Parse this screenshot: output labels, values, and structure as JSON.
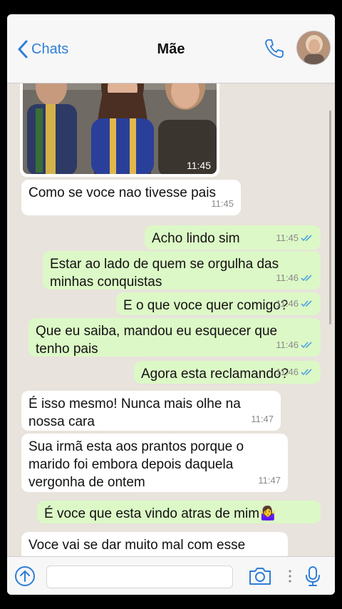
{
  "header": {
    "back_label": "Chats",
    "title": "Mãe"
  },
  "colors": {
    "accent": "#2f7ed8",
    "outgoing_bubble": "#dcf8c6",
    "incoming_bubble": "#ffffff",
    "chat_background": "#e8e3dc",
    "read_ticks": "#4fa3e0"
  },
  "photo_message": {
    "time": "11:45"
  },
  "messages": [
    {
      "direction": "in",
      "lines": [
        "Como se voce nao tivesse pais"
      ],
      "time": "11:45"
    },
    {
      "direction": "out",
      "lines": [
        "Acho lindo sim"
      ],
      "time": "11:45",
      "status": "read"
    },
    {
      "direction": "out",
      "lines": [
        "Estar ao lado de quem se orgulha das",
        "minhas conquistas"
      ],
      "time": "11:46",
      "status": "read"
    },
    {
      "direction": "out",
      "lines": [
        "E o que voce quer comigo?"
      ],
      "time": "11:46",
      "status": "read"
    },
    {
      "direction": "out",
      "lines": [
        "Que eu saiba, mandou eu esquecer que",
        "tenho pais"
      ],
      "time": "11:46",
      "status": "read"
    },
    {
      "direction": "out",
      "lines": [
        "Agora esta reclamando?"
      ],
      "time": "11:46",
      "status": "read"
    },
    {
      "direction": "in",
      "lines": [
        "É isso mesmo! Nunca mais olhe na",
        "nossa cara"
      ],
      "time": "11:47"
    },
    {
      "direction": "in",
      "lines": [
        "Sua irmã esta aos prantos porque o",
        "marido foi embora depois daquela",
        "vergonha de ontem"
      ],
      "time": "11:47"
    },
    {
      "direction": "out",
      "lines": [
        "É voce que esta vindo atras de mim🤷‍♀️"
      ],
      "time": "",
      "status": ""
    },
    {
      "direction": "in",
      "lines": [
        "Voce vai se dar muito mal com esse"
      ],
      "time": ""
    }
  ],
  "input": {
    "placeholder": ""
  }
}
